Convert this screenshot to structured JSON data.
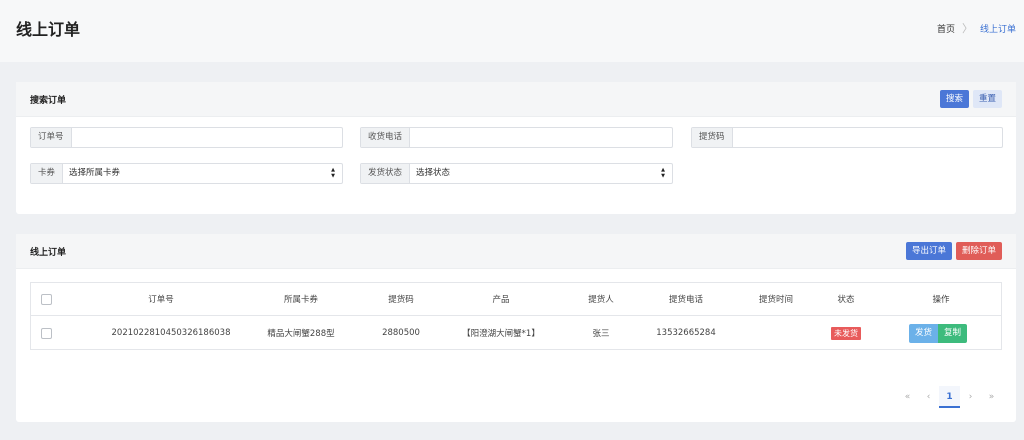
{
  "header": {
    "title": "线上订单",
    "breadcrumb": {
      "home": "首页",
      "sep": "〉",
      "current": "线上订单"
    }
  },
  "search_card": {
    "title": "搜索订单",
    "search_label": "搜索",
    "reset_label": "重置",
    "fields": {
      "order_no": {
        "label": "订单号",
        "value": ""
      },
      "phone": {
        "label": "收货电话",
        "value": ""
      },
      "pickup_code": {
        "label": "提货码",
        "value": ""
      },
      "coupon": {
        "label": "卡券",
        "value": "选择所属卡券"
      },
      "ship_status": {
        "label": "发货状态",
        "value": "选择状态"
      }
    }
  },
  "orders_card": {
    "title": "线上订单",
    "export_label": "导出订单",
    "delete_label": "删除订单",
    "columns": [
      "订单号",
      "所属卡券",
      "提货码",
      "产品",
      "提货人",
      "提货电话",
      "提货时间",
      "状态",
      "操作"
    ],
    "rows": [
      {
        "order_no": "20210228104503261860​38",
        "coupon": "精品大闸蟹288型",
        "pickup_code": "2880500",
        "product": "【阳澄湖大闸蟹*1】",
        "person": "张三",
        "phone": "13532665284",
        "time": "",
        "status": "未发货",
        "ship_label": "发货",
        "copy_label": "复制"
      }
    ],
    "pagination": {
      "first": "«",
      "prev": "‹",
      "current": "1",
      "next": "›",
      "last": "»"
    }
  },
  "colors": {
    "accent": "#4b77d7",
    "danger": "#e05d58",
    "success": "#3dbb7d",
    "info": "#6bb1e9"
  }
}
